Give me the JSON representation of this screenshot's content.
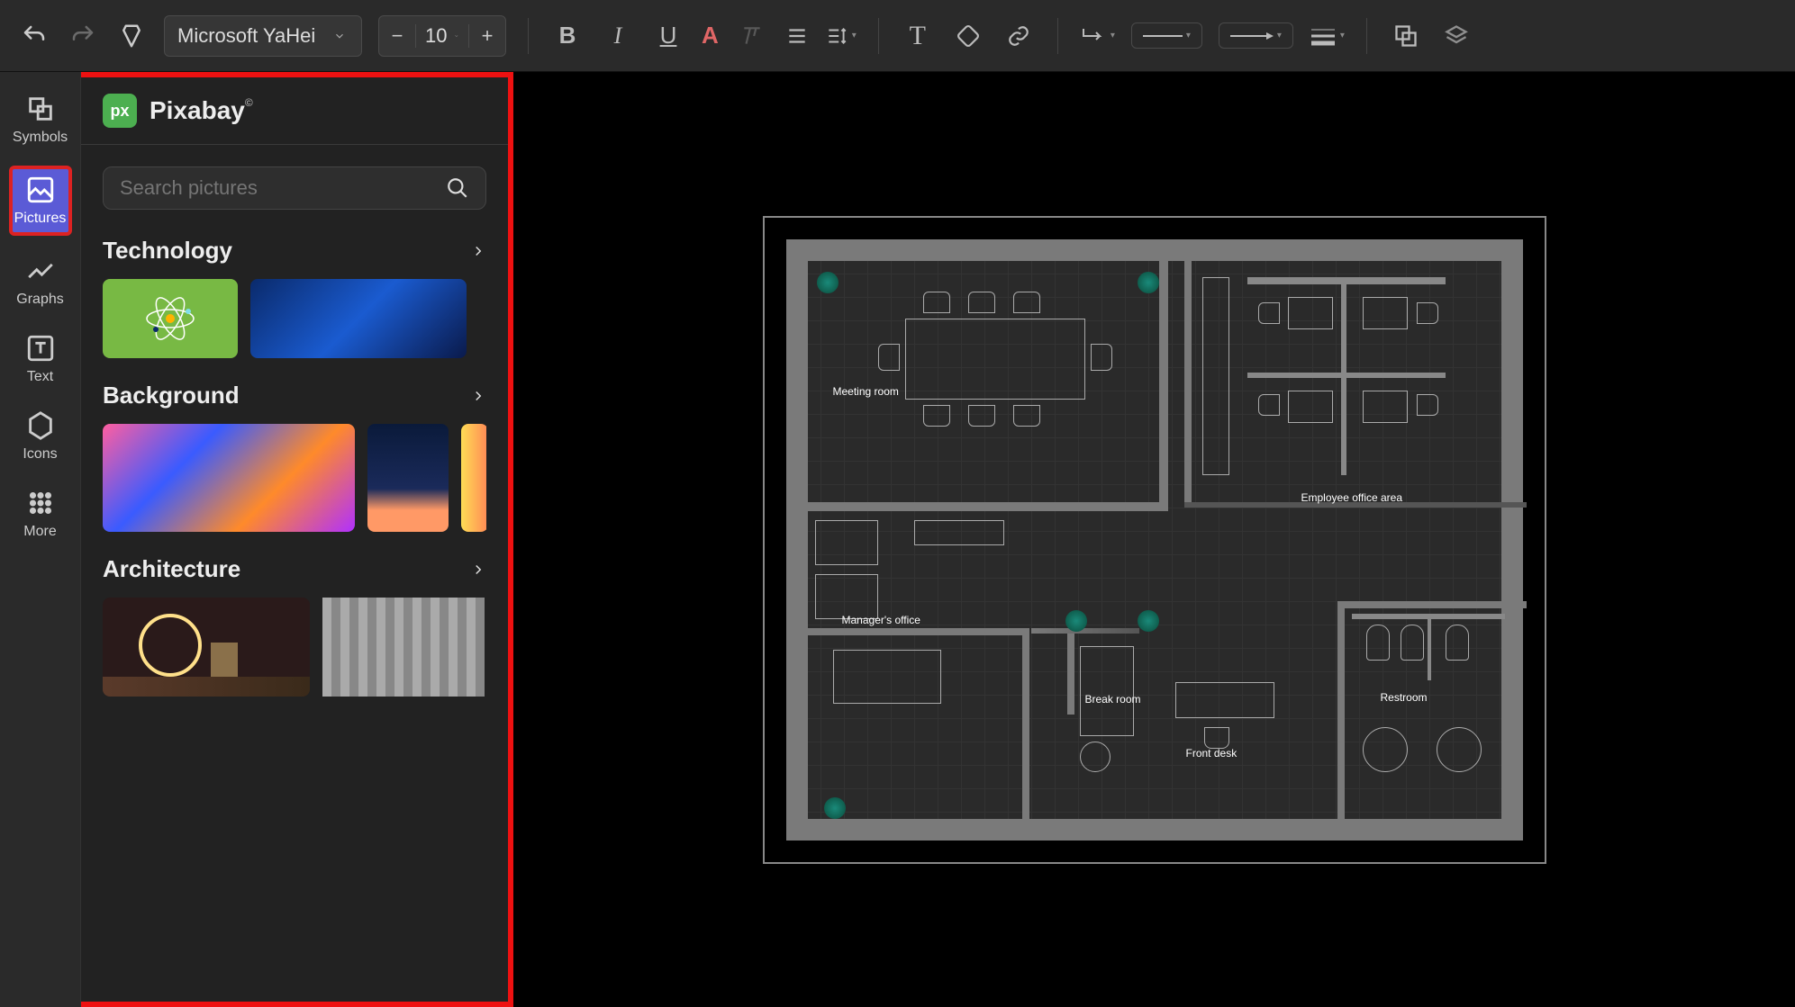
{
  "toolbar": {
    "font_name": "Microsoft YaHei",
    "font_size": "10"
  },
  "left_rail": {
    "items": [
      {
        "label": "Symbols"
      },
      {
        "label": "Pictures"
      },
      {
        "label": "Graphs"
      },
      {
        "label": "Text"
      },
      {
        "label": "Icons"
      },
      {
        "label": "More"
      }
    ]
  },
  "panel": {
    "provider": "Pixabay",
    "provider_badge": "px",
    "search_placeholder": "Search pictures",
    "categories": [
      {
        "title": "Technology"
      },
      {
        "title": "Background"
      },
      {
        "title": "Architecture"
      }
    ]
  },
  "floorplan": {
    "labels": {
      "meeting_room": "Meeting room",
      "employee_office": "Employee office area",
      "managers_office": "Manager's office",
      "break_room": "Break room",
      "front_desk": "Front desk",
      "restroom": "Restroom"
    }
  }
}
